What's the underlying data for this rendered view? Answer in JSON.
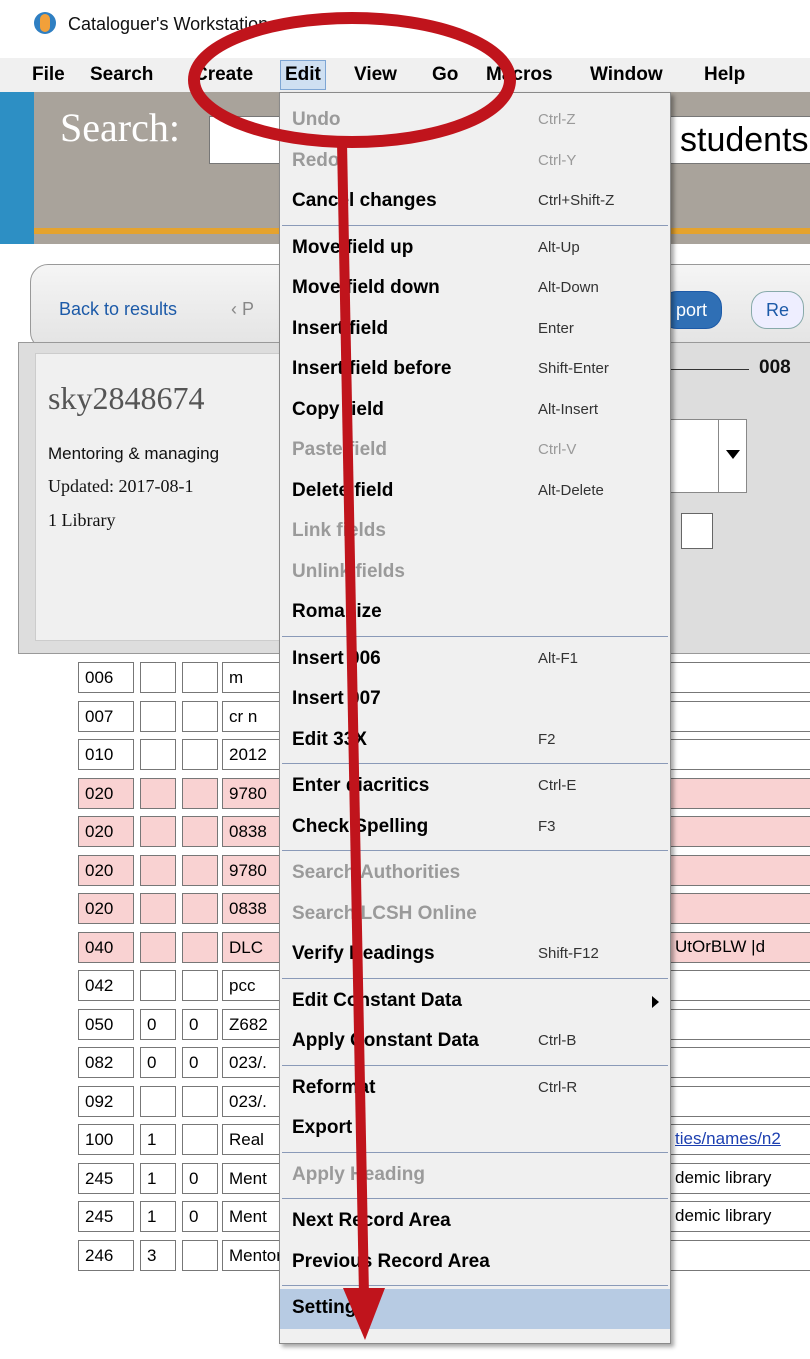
{
  "window": {
    "title": "Cataloguer's Workstation"
  },
  "menubar": {
    "items": [
      "File",
      "Search",
      "Create",
      "Edit",
      "View",
      "Go",
      "Macros",
      "Window",
      "Help"
    ],
    "active": "Edit"
  },
  "search": {
    "label": "Search:",
    "value_fragment": "students"
  },
  "nav": {
    "back": "Back to results",
    "prev": "‹ P",
    "export_fragment": "port",
    "re_fragment": "Re"
  },
  "record": {
    "id": "sky2848674",
    "title": "Mentoring & managing",
    "updated": "Updated: 2017-08-1",
    "libraries": "1 Library",
    "field_008": "008"
  },
  "marc_rows": [
    {
      "tag": "006",
      "i1": "",
      "i2": "",
      "v": "m",
      "pink": false
    },
    {
      "tag": "007",
      "i1": "",
      "i2": "",
      "v": "cr n",
      "pink": false
    },
    {
      "tag": "010",
      "i1": "",
      "i2": "",
      "v": "2012",
      "pink": false
    },
    {
      "tag": "020",
      "i1": "",
      "i2": "",
      "v": "9780",
      "pink": true
    },
    {
      "tag": "020",
      "i1": "",
      "i2": "",
      "v": "0838",
      "pink": true
    },
    {
      "tag": "020",
      "i1": "",
      "i2": "",
      "v": "9780",
      "pink": true
    },
    {
      "tag": "020",
      "i1": "",
      "i2": "",
      "v": "0838",
      "pink": true
    },
    {
      "tag": "040",
      "i1": "",
      "i2": "",
      "v": "DLC",
      "pink": true,
      "tail": "UtOrBLW |d"
    },
    {
      "tag": "042",
      "i1": "",
      "i2": "",
      "v": "pcc",
      "pink": false
    },
    {
      "tag": "050",
      "i1": "0",
      "i2": "0",
      "v": "Z682",
      "pink": false
    },
    {
      "tag": "082",
      "i1": "0",
      "i2": "0",
      "v": "023/.",
      "pink": false
    },
    {
      "tag": "092",
      "i1": "",
      "i2": "",
      "v": "023/.",
      "pink": false
    },
    {
      "tag": "100",
      "i1": "1",
      "i2": "",
      "v": "Real",
      "pink": false,
      "tail": "ties/names/n2"
    },
    {
      "tag": "245",
      "i1": "1",
      "i2": "0",
      "v": "Ment",
      "pink": false,
      "tail": "demic library"
    },
    {
      "tag": "245",
      "i1": "1",
      "i2": "0",
      "v": "Ment",
      "pink": false,
      "tail": "demic library"
    },
    {
      "tag": "246",
      "i1": "3",
      "i2": "",
      "v": "Mentoring and managing students in the academic libra",
      "pink": false
    }
  ],
  "edit_menu": {
    "items": [
      {
        "label": "Undo",
        "shortcut": "Ctrl-Z",
        "disabled": true
      },
      {
        "label": "Redo",
        "shortcut": "Ctrl-Y",
        "disabled": true
      },
      {
        "label": "Cancel changes",
        "shortcut": "Ctrl+Shift-Z",
        "disabled": false
      },
      {
        "label": "Move field up",
        "shortcut": "Alt-Up",
        "disabled": false
      },
      {
        "label": "Move field down",
        "shortcut": "Alt-Down",
        "disabled": false
      },
      {
        "label": "Insert field",
        "shortcut": "Enter",
        "disabled": false
      },
      {
        "label": "Insert field before",
        "shortcut": "Shift-Enter",
        "disabled": false
      },
      {
        "label": "Copy field",
        "shortcut": "Alt-Insert",
        "disabled": false
      },
      {
        "label": "Paste field",
        "shortcut": "Ctrl-V",
        "disabled": true
      },
      {
        "label": "Delete field",
        "shortcut": "Alt-Delete",
        "disabled": false
      },
      {
        "label": "Link fields",
        "shortcut": "",
        "disabled": true
      },
      {
        "label": "Unlink fields",
        "shortcut": "",
        "disabled": true
      },
      {
        "label": "Romanize",
        "shortcut": "",
        "disabled": false
      },
      {
        "label": "Insert 006",
        "shortcut": "Alt-F1",
        "disabled": false
      },
      {
        "label": "Insert 007",
        "shortcut": "",
        "disabled": false
      },
      {
        "label": "Edit 33X",
        "shortcut": "F2",
        "disabled": false
      },
      {
        "label": "Enter diacritics",
        "shortcut": "Ctrl-E",
        "disabled": false
      },
      {
        "label": "Check Spelling",
        "shortcut": "F3",
        "disabled": false
      },
      {
        "label": "Search Authorities",
        "shortcut": "",
        "disabled": true
      },
      {
        "label": "Search LCSH Online",
        "shortcut": "",
        "disabled": true
      },
      {
        "label": "Verify Headings",
        "shortcut": "Shift-F12",
        "disabled": false
      },
      {
        "label": "Edit Constant Data",
        "shortcut": "",
        "disabled": false,
        "submenu": true
      },
      {
        "label": "Apply Constant Data",
        "shortcut": "Ctrl-B",
        "disabled": false
      },
      {
        "label": "Reformat",
        "shortcut": "Ctrl-R",
        "disabled": false
      },
      {
        "label": "Export",
        "shortcut": "",
        "disabled": false
      },
      {
        "label": "Apply Heading",
        "shortcut": "",
        "disabled": true
      },
      {
        "label": "Next Record Area",
        "shortcut": "",
        "disabled": false
      },
      {
        "label": "Previous Record Area",
        "shortcut": "",
        "disabled": false
      },
      {
        "label": "Settings",
        "shortcut": "",
        "disabled": false,
        "highlighted": true
      }
    ]
  },
  "annotation": {
    "color": "#c0141c"
  }
}
